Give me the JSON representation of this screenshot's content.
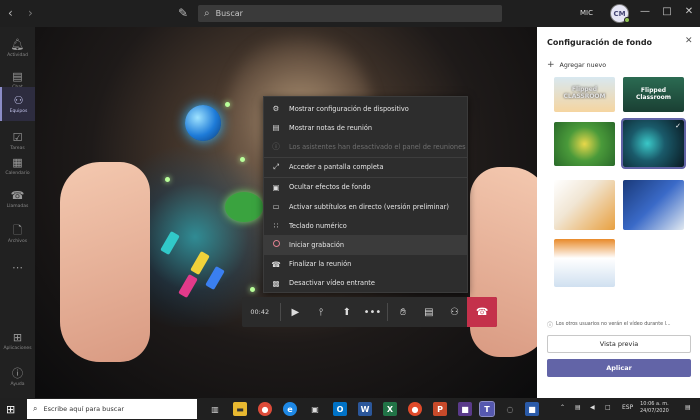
{
  "titlebar": {
    "search_placeholder": "Buscar",
    "org_label": "MIC",
    "avatar_initials": "CM"
  },
  "rail": {
    "items": [
      {
        "label": "Actividad",
        "icon": "bell-icon"
      },
      {
        "label": "Chat",
        "icon": "chat-icon"
      },
      {
        "label": "Equipos",
        "icon": "teams-icon"
      },
      {
        "label": "Tareas",
        "icon": "tasks-icon"
      },
      {
        "label": "Calendario",
        "icon": "calendar-icon"
      },
      {
        "label": "Llamadas",
        "icon": "phone-icon"
      },
      {
        "label": "Archivos",
        "icon": "files-icon"
      },
      {
        "label": "Aplicaciones",
        "icon": "apps-icon"
      },
      {
        "label": "Ayuda",
        "icon": "help-icon"
      }
    ]
  },
  "menu": {
    "items": [
      {
        "label": "Mostrar configuración de dispositivo",
        "icon": "gear-icon"
      },
      {
        "label": "Mostrar notas de reunión",
        "icon": "notes-icon"
      },
      {
        "label": "Los asistentes han desactivado el panel de reuniones",
        "icon": "info-icon"
      },
      {
        "label": "Acceder a pantalla completa",
        "icon": "fullscreen-icon"
      },
      {
        "label": "Ocultar efectos de fondo",
        "icon": "background-icon"
      },
      {
        "label": "Activar subtítulos en directo (versión preliminar)",
        "icon": "captions-icon"
      },
      {
        "label": "Teclado numérico",
        "icon": "keypad-icon"
      },
      {
        "label": "Iniciar grabación",
        "icon": "record-icon"
      },
      {
        "label": "Finalizar la reunión",
        "icon": "end-meeting-icon"
      },
      {
        "label": "Desactivar vídeo entrante",
        "icon": "video-off-icon"
      }
    ]
  },
  "callbar": {
    "timer": "00:42"
  },
  "panel": {
    "title": "Configuración de fondo",
    "add_new": "Agregar nuevo",
    "thumb_captions": [
      "Flipped CLASSROOM",
      "Flipped Classroom"
    ],
    "note": "Los otros usuarios no verán el vídeo durante l...",
    "preview_label": "Vista previa",
    "apply_label": "Aplicar"
  },
  "taskbar": {
    "search_text": "Escribe aquí para buscar",
    "lang": "ESP",
    "time": "10:06 a. m.",
    "date": "24/07/2020"
  },
  "colors": {
    "accent": "#6264a7",
    "hangup": "#c4314b"
  }
}
